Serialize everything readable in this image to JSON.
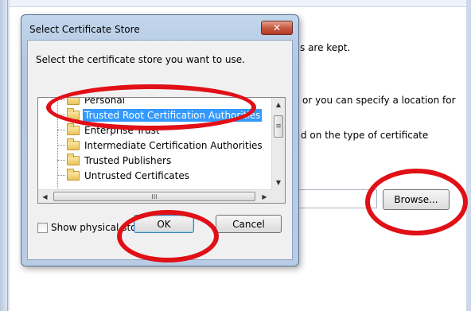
{
  "background_window": {
    "text_lines": [
      "s are kept.",
      "or you can specify a location for",
      "d on the type of certificate"
    ],
    "browse_label": "Browse..."
  },
  "dialog": {
    "title": "Select Certificate Store",
    "close_glyph": "✕",
    "prompt": "Select the certificate store you want to use.",
    "tree_items": [
      {
        "label": "Personal",
        "selected": false
      },
      {
        "label": "Trusted Root Certification Authorities",
        "selected": true
      },
      {
        "label": "Enterprise Trust",
        "selected": false
      },
      {
        "label": "Intermediate Certification Authorities",
        "selected": false
      },
      {
        "label": "Trusted Publishers",
        "selected": false
      },
      {
        "label": "Untrusted Certificates",
        "selected": false
      }
    ],
    "show_physical_stores_label": "Show physical stores",
    "show_physical_stores_checked": false,
    "ok_label": "OK",
    "cancel_label": "Cancel"
  },
  "scrollbars": {
    "up": "▲",
    "down": "▼",
    "left": "◀",
    "right": "▶",
    "v_thumb_grip": "≡",
    "h_thumb_grip": "III"
  },
  "colors": {
    "annotation": "#e01016",
    "selection": "#3399ff"
  },
  "icons": [
    "folder-icon",
    "close-icon",
    "scroll-up-arrow-icon",
    "scroll-down-arrow-icon",
    "scroll-left-arrow-icon",
    "scroll-right-arrow-icon"
  ]
}
